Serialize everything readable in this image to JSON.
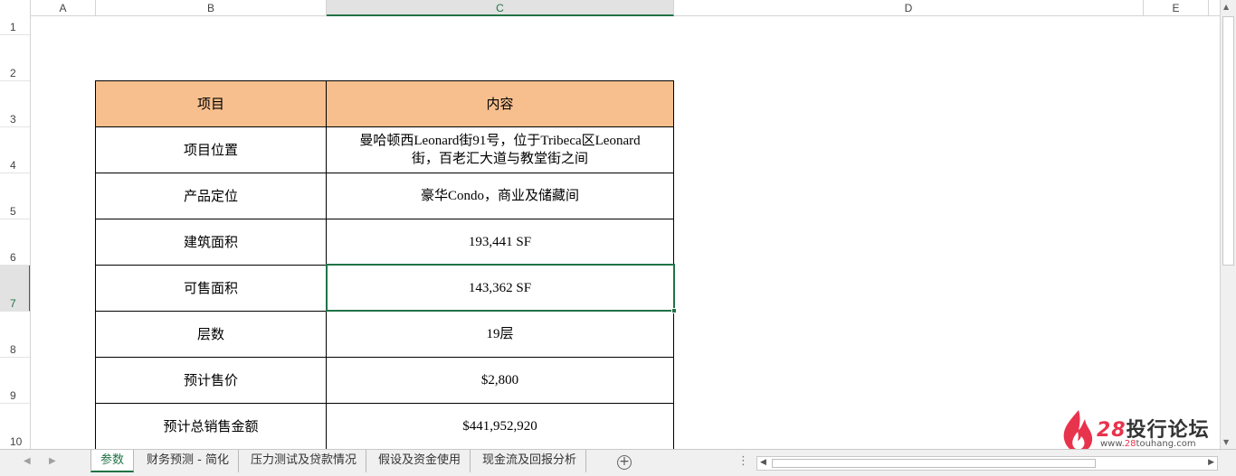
{
  "columns": [
    "A",
    "B",
    "C",
    "D",
    "E"
  ],
  "selected_column": "C",
  "rows": [
    "1",
    "2",
    "3",
    "4",
    "5",
    "6",
    "7",
    "8",
    "9",
    "10"
  ],
  "selected_row": "7",
  "table": {
    "header": {
      "key": "项目",
      "value": "内容"
    },
    "rows": [
      {
        "key": "项目位置",
        "value_line1": "曼哈顿西Leonard街91号，位于Tribeca区Leonard",
        "value_line2": "街，百老汇大道与教堂街之间"
      },
      {
        "key": "产品定位",
        "value": "豪华Condo，商业及储藏间"
      },
      {
        "key": "建筑面积",
        "value": "193,441 SF"
      },
      {
        "key": "可售面积",
        "value": "143,362 SF"
      },
      {
        "key": "层数",
        "value": "19层"
      },
      {
        "key": "预计售价",
        "value": "$2,800"
      },
      {
        "key": "预计总销售金额",
        "value": "$441,952,920"
      }
    ]
  },
  "sheet_tabs": [
    "参数",
    "财务预测 - 简化",
    "压力测试及贷款情况",
    "假设及资金使用",
    "现金流及回报分析"
  ],
  "active_tab": "参数",
  "icons": {
    "add_sheet": "plus-circle-icon",
    "nav_prev": "triangle-left-icon",
    "nav_next": "triangle-right-icon",
    "more": "vertical-ellipsis-icon"
  },
  "watermark": {
    "name_number": "28",
    "name_text": "投行论坛",
    "url_prefix": "www.",
    "url_highlight": "28",
    "url_suffix": "touhang.com"
  },
  "colors": {
    "header_fill": "#f8bf8e",
    "selection": "#217346",
    "logo_red": "#e8334d"
  }
}
